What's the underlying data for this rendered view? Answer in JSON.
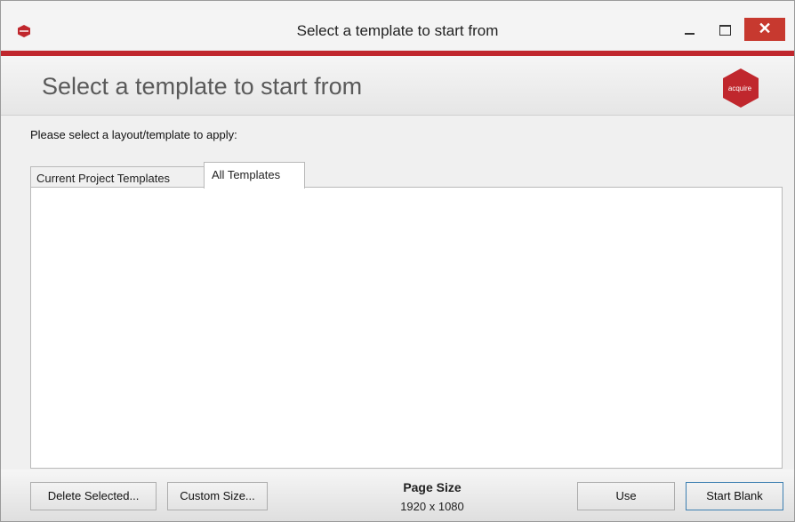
{
  "window": {
    "title": "Select a template to start from",
    "close_glyph": "✕",
    "icons": {
      "app": "acquire-logo-icon",
      "minimize": "minimize-icon",
      "maximize": "maximize-icon",
      "close": "close-icon"
    }
  },
  "banner": {
    "title": "Select a template to start from",
    "logo_text": "acquire"
  },
  "instruction": "Please select a layout/template to apply:",
  "tabs": [
    {
      "label": "Current Project Templates",
      "selected": false
    },
    {
      "label": "All Templates",
      "selected": true
    }
  ],
  "footer": {
    "delete_label": "Delete Selected...",
    "custom_size_label": "Custom Size...",
    "page_size_label": "Page Size",
    "page_size_value": "1920 x 1080",
    "use_label": "Use",
    "start_blank_label": "Start Blank"
  },
  "colors": {
    "accent": "#c0272d",
    "close": "#c7392f"
  }
}
